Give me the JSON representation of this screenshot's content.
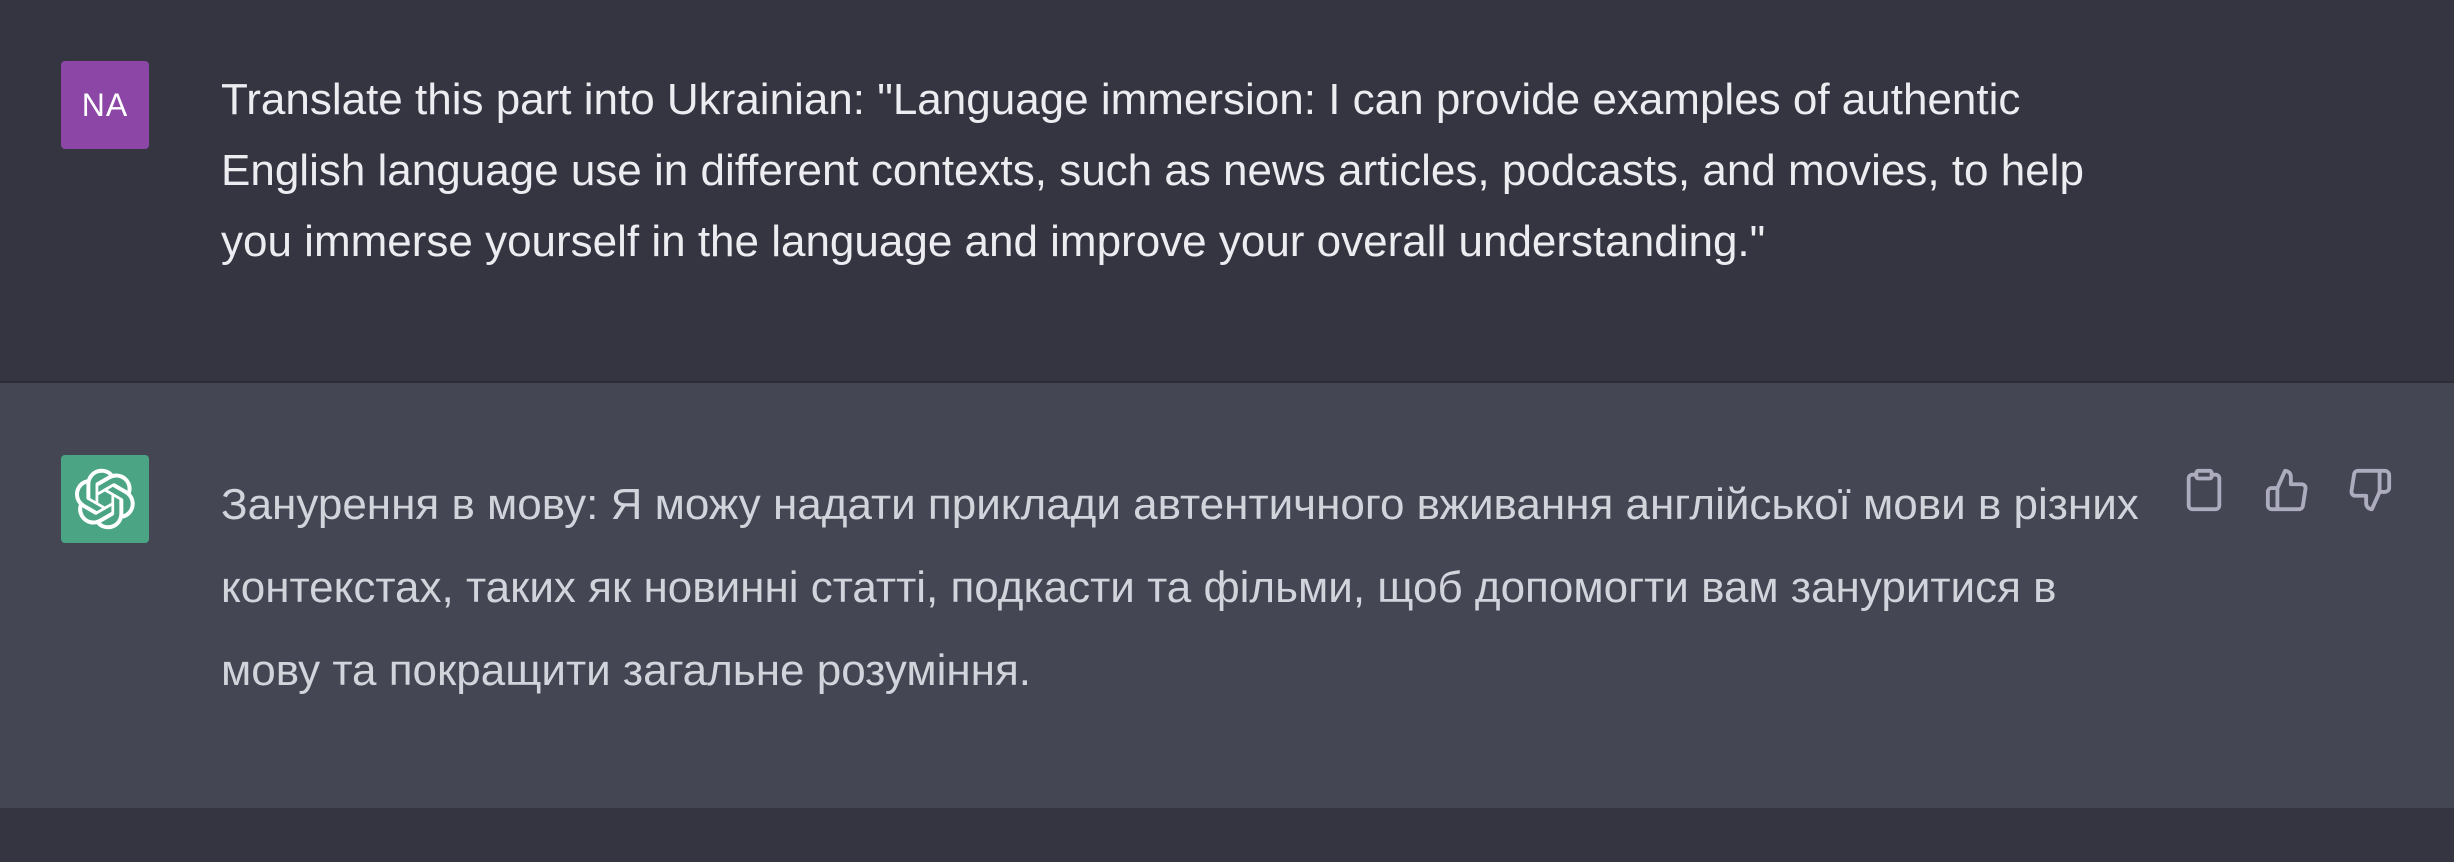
{
  "user_message": {
    "avatar_initials": "NA",
    "avatar_color": "#8b46a6",
    "text": "Translate this part into Ukrainian: \"Language immersion: I can provide examples of authentic English language use in different contexts, such as news articles, podcasts, and movies, to help you immerse yourself in the language and improve your overall understanding.\""
  },
  "assistant_message": {
    "avatar_icon": "openai-logo-icon",
    "avatar_color": "#19c37d",
    "text": "Занурення в мову: Я можу надати приклади автентичного вживання англійської мови в різних контекстах, таких як новинні статті, подкасти та фільми, щоб допомогти вам зануритися в мову та покращити загальне розуміння.",
    "actions": [
      {
        "icon": "clipboard-icon",
        "label": "Copy"
      },
      {
        "icon": "thumbs-up-icon",
        "label": "Good response"
      },
      {
        "icon": "thumbs-down-icon",
        "label": "Bad response"
      }
    ]
  },
  "colors": {
    "user_bg": "#343541",
    "assistant_bg": "#444654",
    "text_primary": "#ececf1",
    "text_secondary": "#d1d5db",
    "icon": "#acacbe"
  }
}
